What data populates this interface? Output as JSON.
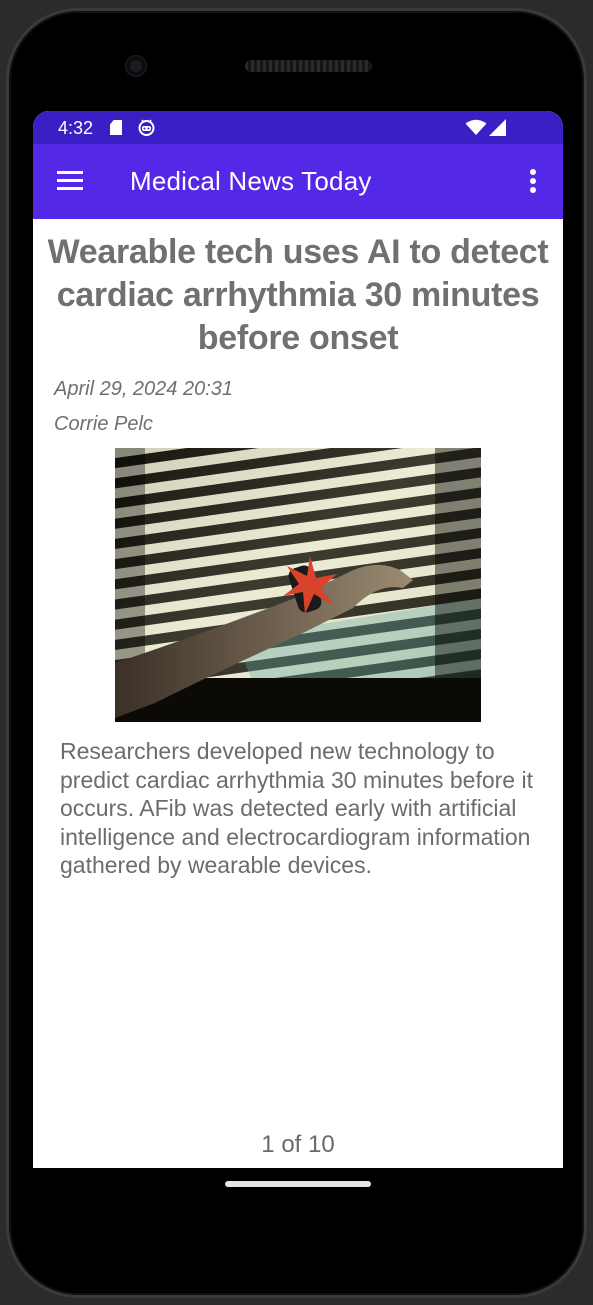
{
  "status_bar": {
    "time": "4:32",
    "icons": [
      "sd-card-icon",
      "robot-icon",
      "wifi-icon",
      "signal-icon"
    ]
  },
  "app_bar": {
    "title": "Medical News Today",
    "menu_icon": "hamburger-menu-icon",
    "overflow_icon": "more-vert-icon"
  },
  "article": {
    "title": "Wearable tech uses AI to detect cardiac arrhythmia 30 minutes before onset",
    "date": "April 29, 2024 20:31",
    "author": "Corrie Pelc",
    "summary": "Researchers developed new technology to predict cardiac arrhythmia 30 minutes before it occurs. AFib was detected early with artificial intelligence and electrocardiogram information gathered by wearable devices."
  },
  "pager": {
    "label": "1 of 10"
  },
  "colors": {
    "status_bar": "#3c1fc4",
    "app_bar": "#5328e6",
    "text_gray": "#707070"
  }
}
